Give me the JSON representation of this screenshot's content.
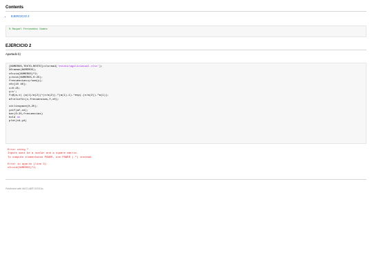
{
  "toc": {
    "title": "Contents",
    "items": [
      {
        "label": "EJERCICIO 2"
      }
    ]
  },
  "author_comment": "% Raquel Fernandez Gomez",
  "section": {
    "title": "EJERCICIO 2",
    "subtitle": "Apartado b)"
  },
  "code": {
    "line1_pre": "[NUMEROS,TEXTO,RESTO]=xlsread(",
    "line1_str": "'estaturagaliciasual.xlsx'",
    "line1_post": ");",
    "lines_a": [
      "X0=mean(NUMEROS);",
      "c0=std(NUMEROS)^2;",
      "y=hist(NUMEROS,0:25);",
      "frecuencias=y/sum(y);",
      "x0=[10 40];",
      "x=0:25;",
      "y=x';",
      "f=@(a,x) (a(1)/a(2))*(x/a(2)).^(a(1)-1).*exp(-(x/a(2)).^a(1));",
      "af=nlinfit(x,frecuencias,f,x0);",
      "",
      "xd=linspace(0,25);",
      "yd=f(af,xd);",
      "bar(0:25,frecuencias)"
    ],
    "hold_cmd": "hold",
    "hold_arg": "on",
    "last_line": "plot(xd,yd)"
  },
  "error_output": [
    "Error using ^",
    "Inputs must be a scalar and a square matrix.",
    "To compute elementwise POWER, use POWER (.^) instead.",
    "",
    "Error in apartb (line 3)",
    "c0=std(NUMEROS)^2;"
  ],
  "footer": "Published with MATLAB® R2015a"
}
